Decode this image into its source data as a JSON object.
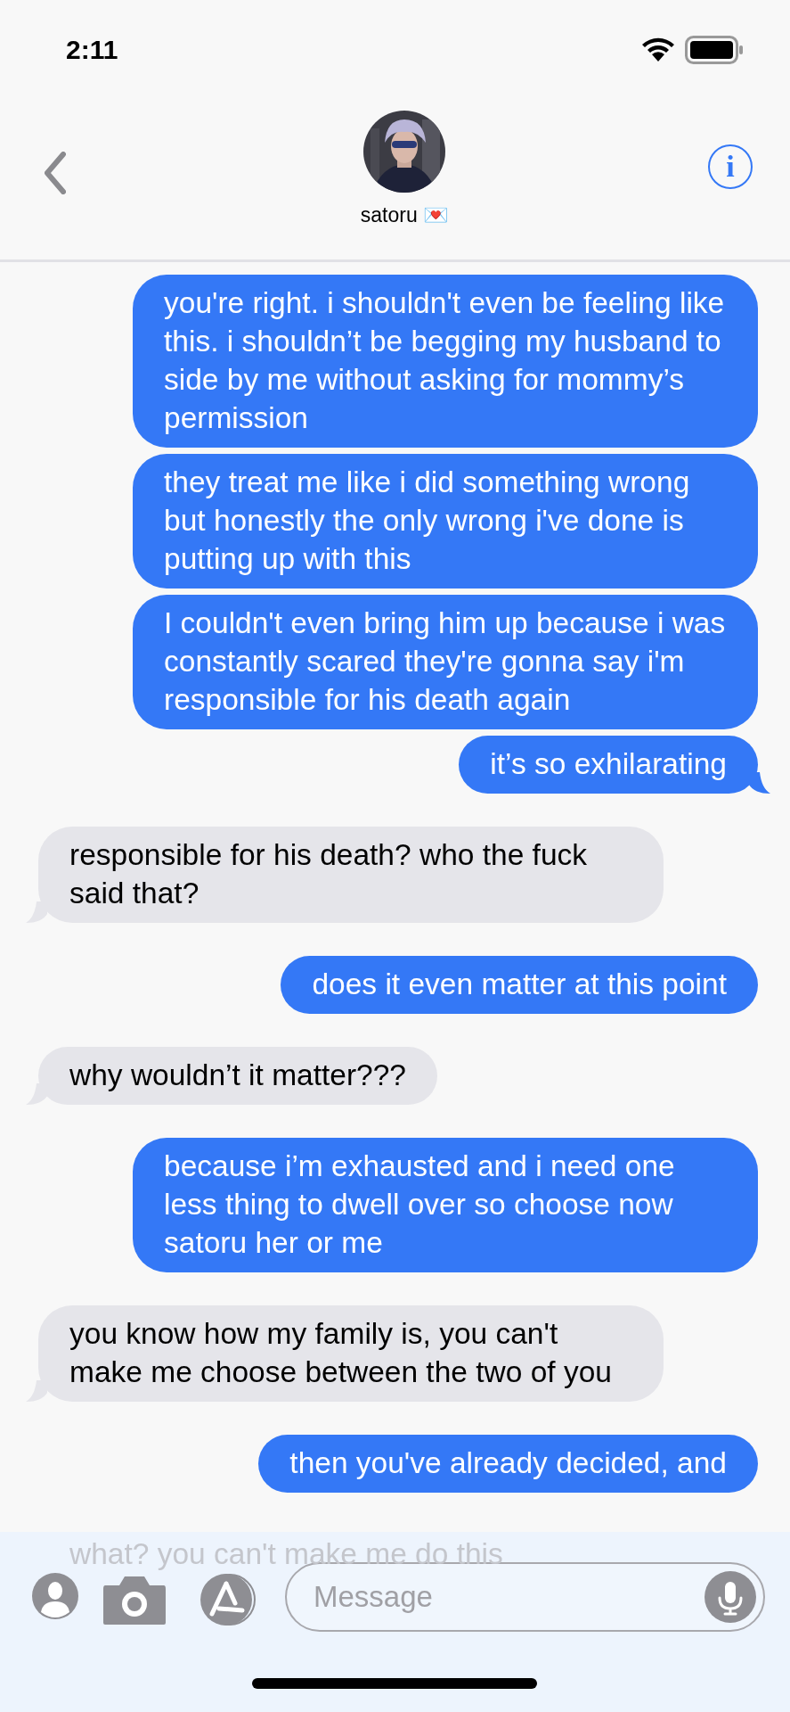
{
  "status_bar": {
    "time": "2:11"
  },
  "header": {
    "contact_name": "satoru 💌",
    "info": "i"
  },
  "messages": [
    {
      "text": "you're right. i shouldn't even be feeling like this. i shouldn’t be begging my husband to side by me without asking for mommy’s permission",
      "kind": "outgoing",
      "tail": false
    },
    {
      "text": "they treat me like i did something wrong but honestly the only wrong i've done is putting up with this",
      "kind": "outgoing",
      "tail": false
    },
    {
      "text": "I couldn't even bring him up because i was constantly scared they're gonna say i'm responsible for his death again",
      "kind": "outgoing",
      "tail": false
    },
    {
      "text": "it’s so exhilarating",
      "kind": "outgoing",
      "tail": true
    },
    {
      "text": "responsible for his death? who the fuck said that?",
      "kind": "incoming",
      "tail": true
    },
    {
      "text": "does it even matter at this point",
      "kind": "outgoing",
      "tail": false
    },
    {
      "text": "why wouldn’t it matter???",
      "kind": "incoming",
      "tail": true
    },
    {
      "text": "because i’m exhausted and i need one less thing to dwell over so choose now satoru her or me",
      "kind": "outgoing",
      "tail": false
    },
    {
      "text": "you know how my family is, you can't make me choose between the two of you",
      "kind": "incoming",
      "tail": true
    },
    {
      "text": "then you've already decided, and",
      "kind": "outgoing",
      "tail": false
    },
    {
      "text": "what? you can't make me do this",
      "kind": "incoming"
    }
  ],
  "composer": {
    "placeholder": "Message"
  }
}
